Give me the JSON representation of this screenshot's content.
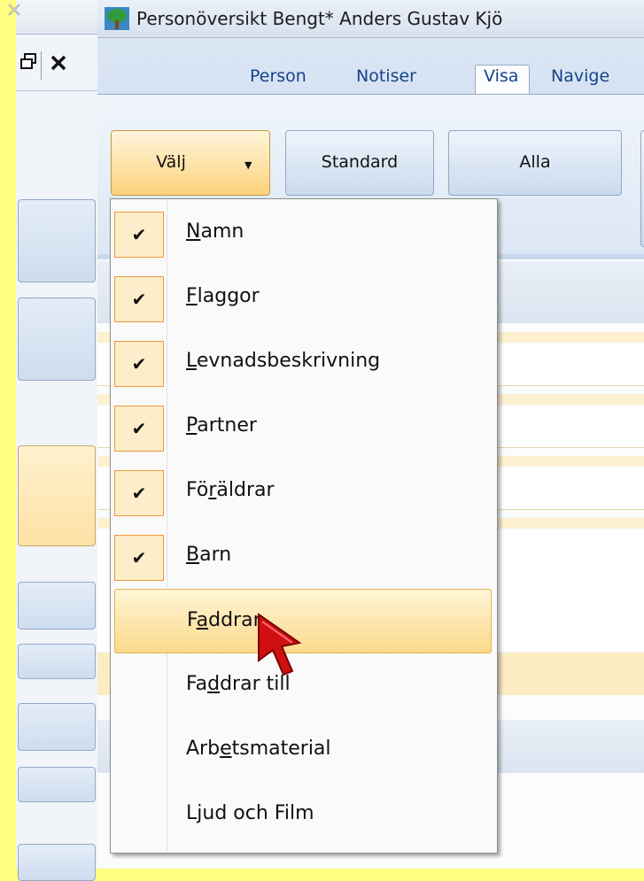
{
  "window": {
    "title": "Personöversikt Bengt* Anders Gustav Kjö"
  },
  "ribbon": {
    "tabs": [
      "Person",
      "Notiser",
      "Visa",
      "Navige"
    ],
    "active_tab": "Visa",
    "buttons": {
      "valj": "Välj",
      "standard": "Standard",
      "alla": "Alla"
    }
  },
  "menu": {
    "items": [
      {
        "mnemonic": "N",
        "rest": "amn",
        "checked": true
      },
      {
        "mnemonic": "F",
        "rest": "laggor",
        "checked": true
      },
      {
        "mnemonic": "L",
        "rest": "evnadsbeskrivning",
        "checked": true
      },
      {
        "mnemonic": "P",
        "rest": "artner",
        "checked": true
      },
      {
        "pre": "Fö",
        "mnemonic": "r",
        "rest": "äldrar",
        "checked": true
      },
      {
        "mnemonic": "B",
        "rest": "arn",
        "checked": true
      },
      {
        "pre": "F",
        "mnemonic": "a",
        "rest": "ddrar",
        "checked": false
      },
      {
        "pre": "Fa",
        "mnemonic": "d",
        "rest": "drar till",
        "checked": false
      },
      {
        "pre": "Arb",
        "mnemonic": "e",
        "rest": "tsmaterial",
        "checked": false
      },
      {
        "pre": "L",
        "mnemonic": "j",
        "rest": "ud och Film",
        "checked": false
      }
    ],
    "highlighted": "Faddrar"
  },
  "icons": {
    "check": "✔"
  },
  "colors": {
    "accent": "#fbd98b",
    "ribbon_text": "#15428b",
    "checkbox_border": "#f29536"
  }
}
